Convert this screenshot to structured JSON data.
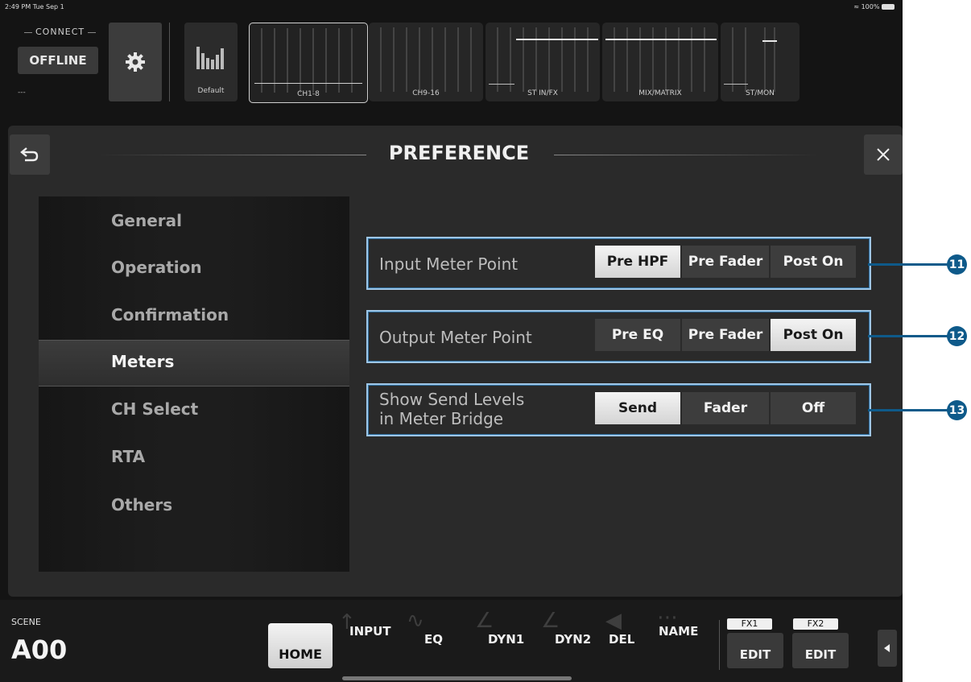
{
  "status": {
    "time": "2:49 PM  Tue Sep 1",
    "battery": "100%"
  },
  "connect": {
    "label": "CONNECT",
    "button": "OFFLINE",
    "sub": "---"
  },
  "meter_bridge": {
    "default_label": "Default",
    "banks": [
      {
        "label": "CH1-8",
        "selected": true
      },
      {
        "label": "CH9-16",
        "selected": false
      },
      {
        "label": "ST IN/FX",
        "selected": false
      },
      {
        "label": "MIX/MATRIX",
        "selected": false
      },
      {
        "label": "ST/MON",
        "selected": false
      }
    ]
  },
  "panel": {
    "title": "PREFERENCE"
  },
  "sidebar": {
    "items": [
      {
        "label": "General"
      },
      {
        "label": "Operation"
      },
      {
        "label": "Confirmation"
      },
      {
        "label": "Meters",
        "active": true
      },
      {
        "label": "CH Select"
      },
      {
        "label": "RTA"
      },
      {
        "label": "Others"
      }
    ]
  },
  "settings": [
    {
      "label": "Input Meter Point",
      "options": [
        "Pre HPF",
        "Pre Fader",
        "Post On"
      ],
      "selected": "Pre HPF",
      "callout": "11"
    },
    {
      "label": "Output Meter Point",
      "options": [
        "Pre EQ",
        "Pre Fader",
        "Post On"
      ],
      "selected": "Post On",
      "callout": "12"
    },
    {
      "label_line1": "Show Send Levels",
      "label_line2": "in Meter Bridge",
      "options": [
        "Send",
        "Fader",
        "Off"
      ],
      "selected": "Send",
      "callout": "13"
    }
  ],
  "bottom": {
    "scene_label": "SCENE",
    "scene_value": "A00",
    "tabs": [
      "HOME",
      "INPUT",
      "EQ",
      "DYN1",
      "DYN2",
      "DEL",
      "NAME"
    ],
    "fx1_label": "FX1",
    "fx2_label": "FX2",
    "edit_label": "EDIT"
  },
  "colors": {
    "callout": "#0e5a8a",
    "highlight_border": "#9ec6e6"
  }
}
